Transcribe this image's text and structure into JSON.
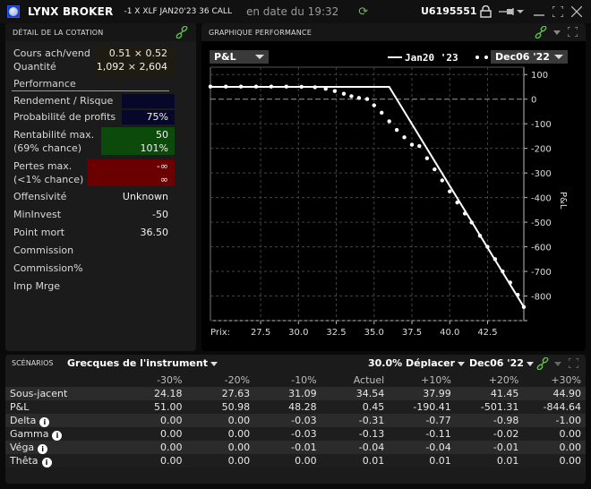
{
  "titlebar": {
    "brand": "LYNX BROKER",
    "instrument": "-1 X XLF JAN20'23 36 CALL",
    "date": "en date du 19:32",
    "account": "U6195551"
  },
  "quote_panel": {
    "title": "DÉTAIL DE LA COTATION",
    "bid_ask_label": "Cours ach/vend",
    "bid_ask_value": "0.51 × 0.52",
    "quantity_label": "Quantité",
    "quantity_value": "1,092 × 2,604",
    "performance_label": "Performance",
    "rows": {
      "return_risk_label": "Rendement / Risque",
      "return_risk_value": "",
      "prob_profit_label": "Probabilité de profits",
      "prob_profit_value": "75%",
      "max_profit_label": "Rentabilité max.",
      "max_profit_chance": "(69% chance)",
      "max_profit_value": "50",
      "max_profit_pct": "101%",
      "max_loss_label": "Pertes max.",
      "max_loss_chance": "(<1% chance)",
      "max_loss_value": "-∞",
      "max_loss_pct": "∞",
      "aggressiveness_label": "Offensivité",
      "aggressiveness_value": "Unknown",
      "min_invest_label": "MinInvest",
      "min_invest_value": "-50",
      "breakeven_label": "Point mort",
      "breakeven_value": "36.50",
      "commission_label": "Commission",
      "commission_pct_label": "Commission%",
      "margin_label": "Imp Mrge"
    },
    "colors": {
      "return_box": "#07072a",
      "profit_box": "#0b4a0b",
      "loss_box": "#6b0000"
    }
  },
  "chart_panel": {
    "title": "GRAPHIQUE PERFORMANCE",
    "metric_dropdown": "P&L",
    "date_dropdown": "Dec06 '22"
  },
  "chart_data": {
    "type": "line",
    "xlabel": "Prix:",
    "ylabel": "P&L",
    "xlim": [
      24.18,
      44.9
    ],
    "ylim": [
      -900,
      130
    ],
    "xticks": [
      27.5,
      30.0,
      32.5,
      35.0,
      37.5,
      40.0,
      42.5
    ],
    "xtick_labels": [
      "27.5",
      "30.0",
      "32.5",
      "35.0",
      "37.5",
      "40.0",
      "42.5"
    ],
    "yticks": [
      100,
      0,
      -100,
      -200,
      -300,
      -400,
      -500,
      -600,
      -700,
      -800
    ],
    "ytick_labels": [
      "100",
      "0",
      "-100",
      "-200",
      "-300",
      "-400",
      "-500",
      "-600",
      "-700",
      "-800"
    ],
    "grid": true,
    "legend_position": "top-right",
    "series": [
      {
        "name": "Jan20 '23",
        "style": "solid",
        "x": [
          24.18,
          36.0,
          44.9
        ],
        "y": [
          50,
          50,
          -844.64
        ]
      },
      {
        "name": "Dec06 '22",
        "style": "dotted",
        "x": [
          24.18,
          25.2,
          26.2,
          27.2,
          28.2,
          29.2,
          30.2,
          31.09,
          31.8,
          32.4,
          33.0,
          33.5,
          34.0,
          34.54,
          35.0,
          35.5,
          36.0,
          36.5,
          37.0,
          37.5,
          37.99,
          38.5,
          39.0,
          39.5,
          40.0,
          40.5,
          41.0,
          41.45,
          42.0,
          42.5,
          43.0,
          43.5,
          44.0,
          44.5,
          44.9
        ],
        "y": [
          51.0,
          51.0,
          51.0,
          51.0,
          50.98,
          50.9,
          50.0,
          48.28,
          42,
          33,
          22,
          12,
          5,
          0.45,
          -25,
          -55,
          -90,
          -125,
          -155,
          -185,
          -190.41,
          -240,
          -285,
          -330,
          -375,
          -420,
          -465,
          -501.31,
          -555,
          -600,
          -650,
          -700,
          -745,
          -795,
          -844.64
        ]
      }
    ]
  },
  "scenarios": {
    "title": "SCÉNARIOS",
    "greeks_dropdown": "Grecques de l'instrument",
    "move_dropdown": "30.0% Déplacer",
    "date_dropdown": "Dec06 '22",
    "columns": [
      "-30%",
      "-20%",
      "-10%",
      "Actuel",
      "+10%",
      "+20%",
      "+30%"
    ],
    "rows": [
      {
        "label": "Sous-jacent",
        "info": false,
        "values": [
          "24.18",
          "27.63",
          "31.09",
          "34.54",
          "37.99",
          "41.45",
          "44.90"
        ]
      },
      {
        "label": "P&L",
        "info": false,
        "values": [
          "51.00",
          "50.98",
          "48.28",
          "0.45",
          "-190.41",
          "-501.31",
          "-844.64"
        ]
      },
      {
        "label": "Delta",
        "info": true,
        "values": [
          "0.00",
          "0.00",
          "-0.03",
          "-0.31",
          "-0.77",
          "-0.98",
          "-1.00"
        ]
      },
      {
        "label": "Gamma",
        "info": true,
        "values": [
          "0.00",
          "0.00",
          "-0.03",
          "-0.13",
          "-0.11",
          "-0.02",
          "0.00"
        ]
      },
      {
        "label": "Véga",
        "info": true,
        "values": [
          "0.00",
          "0.00",
          "-0.01",
          "-0.04",
          "-0.04",
          "-0.01",
          "0.00"
        ]
      },
      {
        "label": "Thêta",
        "info": true,
        "values": [
          "0.00",
          "0.00",
          "0.00",
          "0.01",
          "0.01",
          "0.01",
          "0.00"
        ]
      }
    ]
  },
  "icons": {
    "logo": "globe-icon",
    "refresh": "refresh-icon",
    "lock": "lock-icon",
    "pin": "pin-icon",
    "link": "link-icon",
    "minimize": "minimize-icon",
    "maximize": "maximize-icon",
    "close": "close-icon",
    "info": "info-icon"
  },
  "info_glyph": "i"
}
